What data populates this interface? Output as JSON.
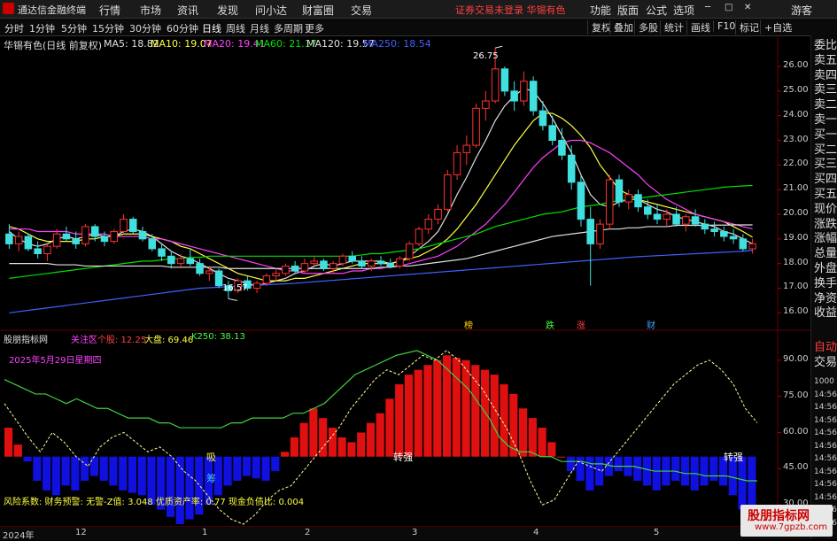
{
  "titlebar": {
    "app_name": "通达信金融终端",
    "menu": [
      "行情",
      "市场",
      "资讯",
      "发现",
      "问小达",
      "财富圈",
      "交易"
    ],
    "promo": "证券交易未登录  华锡有色",
    "right_buttons": [
      "功能",
      "版面",
      "公式",
      "选项"
    ],
    "guest": "游客"
  },
  "toolbar": {
    "timeframes": [
      "分时",
      "1分钟",
      "5分钟",
      "15分钟",
      "30分钟",
      "60分钟",
      "日线",
      "周线",
      "月线",
      "多周期",
      "更多"
    ],
    "active_timeframe": "日线",
    "buttons": [
      "复权",
      "叠加",
      "多股",
      "统计",
      "画线",
      "F10",
      "标记",
      "+自选"
    ]
  },
  "ma_legend": {
    "stock": "华锡有色(日线 前复权)",
    "items": [
      {
        "label": "MA5: 18.82",
        "color": "#e0e0e0"
      },
      {
        "label": "MA10: 19.07",
        "color": "#ffff40"
      },
      {
        "label": "MA20: 19.41",
        "color": "#ff40ff"
      },
      {
        "label": "MA60: 21.17",
        "color": "#00e000"
      },
      {
        "label": "MA120: 19.57",
        "color": "#e0e0e0"
      },
      {
        "label": "MA250: 18.54",
        "color": "#4060ff"
      }
    ]
  },
  "right_panel": [
    "委比",
    "卖五",
    "卖四",
    "卖三",
    "卖二",
    "卖一",
    "买一",
    "买二",
    "买三",
    "买四",
    "买五",
    "现价",
    "涨跌",
    "涨幅",
    "总量",
    "外盘",
    "换手",
    "净资",
    "收益"
  ],
  "right_panel_lower": [
    "自动",
    "交易"
  ],
  "right_small_ticks": [
    "1000",
    "14:56",
    "14:56",
    "14:56",
    "14:56",
    "14:56",
    "14:56",
    "14:56",
    "14:56",
    "14:56",
    "14:56",
    "14:56"
  ],
  "main_price_labels": [
    "26.00",
    "25.00",
    "24.00",
    "23.00",
    "22.00",
    "21.00",
    "20.00",
    "19.00",
    "18.00",
    "17.00",
    "16.00"
  ],
  "high_marker": "26.75",
  "low_marker": "16.57",
  "event_labels": [
    {
      "text": "榜",
      "color": "#ffd000"
    },
    {
      "text": "跌",
      "color": "#40ff40"
    },
    {
      "text": "涨",
      "color": "#ff4040"
    },
    {
      "text": "财",
      "color": "#40a0ff"
    }
  ],
  "indicator": {
    "name": "股朋指标网",
    "zone_label": "关注区",
    "dash": "-",
    "stock_label": "个股: 12.25",
    "market_label": "大盘: 69.46",
    "k250_label": "K250: 38.13",
    "date_text": "2025年5月29日星期四",
    "axis_labels": [
      "90.00",
      "75.00",
      "60.00",
      "45.00",
      "30.00"
    ],
    "text_absorb": "吸",
    "text_chip": "筹",
    "text_turn1": "转强",
    "text_turn2": "转强",
    "risk_text": "风险系数: 财务预警: 无警-Z值: 3.048 优质资产率: 0.77 现金负债比: 0.004"
  },
  "xaxis": [
    "2024年",
    "12",
    "1",
    "2",
    "3",
    "4",
    "5"
  ],
  "watermark": {
    "title": "股朋指标网",
    "url": "www.7gpzb.com"
  },
  "chart_data": {
    "type": "candlestick",
    "title": "华锡有色(日线 前复权)",
    "ylim": [
      15.4,
      26.9
    ],
    "high": 26.75,
    "low": 16.57,
    "candles": [
      [
        19.2,
        19.6,
        18.6,
        18.8
      ],
      [
        18.8,
        19.3,
        18.5,
        19.1
      ],
      [
        19.1,
        19.2,
        18.5,
        18.6
      ],
      [
        18.6,
        18.9,
        18.2,
        18.4
      ],
      [
        18.4,
        18.8,
        18.1,
        18.7
      ],
      [
        18.7,
        19.4,
        18.6,
        19.2
      ],
      [
        19.2,
        19.5,
        18.9,
        19.0
      ],
      [
        19.0,
        19.3,
        18.6,
        18.8
      ],
      [
        18.8,
        19.6,
        18.7,
        19.5
      ],
      [
        19.5,
        19.6,
        18.9,
        19.1
      ],
      [
        19.1,
        19.3,
        18.7,
        18.9
      ],
      [
        18.9,
        19.4,
        18.8,
        19.3
      ],
      [
        19.3,
        20.0,
        19.2,
        19.8
      ],
      [
        19.8,
        19.9,
        19.2,
        19.3
      ],
      [
        19.3,
        19.5,
        18.9,
        19.0
      ],
      [
        19.0,
        19.2,
        18.5,
        18.6
      ],
      [
        18.6,
        18.8,
        18.1,
        18.3
      ],
      [
        18.3,
        18.5,
        17.8,
        18.0
      ],
      [
        18.0,
        18.4,
        17.8,
        18.2
      ],
      [
        18.2,
        18.6,
        17.9,
        18.0
      ],
      [
        18.0,
        18.2,
        17.5,
        17.6
      ],
      [
        17.6,
        17.9,
        17.3,
        17.7
      ],
      [
        17.7,
        17.8,
        17.0,
        17.1
      ],
      [
        17.1,
        17.3,
        16.57,
        16.9
      ],
      [
        16.9,
        17.4,
        16.8,
        17.3
      ],
      [
        17.3,
        17.5,
        16.9,
        17.0
      ],
      [
        17.0,
        17.3,
        16.8,
        17.2
      ],
      [
        17.2,
        17.6,
        17.1,
        17.5
      ],
      [
        17.5,
        17.8,
        17.3,
        17.6
      ],
      [
        17.6,
        18.0,
        17.5,
        17.9
      ],
      [
        17.9,
        18.1,
        17.6,
        17.7
      ],
      [
        17.7,
        18.2,
        17.6,
        18.0
      ],
      [
        18.0,
        18.3,
        17.8,
        18.1
      ],
      [
        18.1,
        18.2,
        17.7,
        17.8
      ],
      [
        17.8,
        18.1,
        17.6,
        18.0
      ],
      [
        18.0,
        18.4,
        17.9,
        18.3
      ],
      [
        18.3,
        18.5,
        18.0,
        18.1
      ],
      [
        18.1,
        18.3,
        17.8,
        17.9
      ],
      [
        17.9,
        18.2,
        17.7,
        18.1
      ],
      [
        18.1,
        18.3,
        17.9,
        18.0
      ],
      [
        18.0,
        18.2,
        17.8,
        17.9
      ],
      [
        17.9,
        18.3,
        17.8,
        18.2
      ],
      [
        18.2,
        18.9,
        18.1,
        18.8
      ],
      [
        18.8,
        19.5,
        18.7,
        19.4
      ],
      [
        19.4,
        20.0,
        19.2,
        19.8
      ],
      [
        19.8,
        20.4,
        19.6,
        20.2
      ],
      [
        20.2,
        21.8,
        20.1,
        21.6
      ],
      [
        21.6,
        22.8,
        21.4,
        22.5
      ],
      [
        22.5,
        23.2,
        22.0,
        22.8
      ],
      [
        22.8,
        24.5,
        22.7,
        24.3
      ],
      [
        24.3,
        25.0,
        23.8,
        24.6
      ],
      [
        24.6,
        26.75,
        24.5,
        25.9
      ],
      [
        25.9,
        26.0,
        24.8,
        25.0
      ],
      [
        25.0,
        25.4,
        24.2,
        24.6
      ],
      [
        24.6,
        25.8,
        24.4,
        25.4
      ],
      [
        25.4,
        25.6,
        24.0,
        24.2
      ],
      [
        24.2,
        24.6,
        23.4,
        23.6
      ],
      [
        23.6,
        24.0,
        22.8,
        23.0
      ],
      [
        23.0,
        23.5,
        22.2,
        22.4
      ],
      [
        22.4,
        22.8,
        21.0,
        21.3
      ],
      [
        21.3,
        21.6,
        19.5,
        19.8
      ],
      [
        19.8,
        20.3,
        17.1,
        18.8
      ],
      [
        18.8,
        19.8,
        18.6,
        19.6
      ],
      [
        19.6,
        21.6,
        19.4,
        21.4
      ],
      [
        21.4,
        21.6,
        20.3,
        20.5
      ],
      [
        20.5,
        21.0,
        20.2,
        20.8
      ],
      [
        20.8,
        21.0,
        20.1,
        20.3
      ],
      [
        20.3,
        20.6,
        19.8,
        20.0
      ],
      [
        20.0,
        20.4,
        19.6,
        19.8
      ],
      [
        19.8,
        20.2,
        19.5,
        20.0
      ],
      [
        20.0,
        20.3,
        19.5,
        19.6
      ],
      [
        19.6,
        20.0,
        19.3,
        19.9
      ],
      [
        19.9,
        20.2,
        19.5,
        19.6
      ],
      [
        19.6,
        19.8,
        19.2,
        19.4
      ],
      [
        19.4,
        19.7,
        19.1,
        19.3
      ],
      [
        19.3,
        19.5,
        18.9,
        19.1
      ],
      [
        19.1,
        19.4,
        18.8,
        19.0
      ],
      [
        19.0,
        19.2,
        18.5,
        18.6
      ],
      [
        18.6,
        19.0,
        18.4,
        18.8
      ]
    ],
    "ma_series": [
      {
        "name": "MA5",
        "color": "#e0e0e0",
        "values": [
          19.3,
          19.0,
          18.8,
          18.7,
          18.8,
          19.0,
          19.1,
          19.0,
          19.1,
          19.2,
          19.1,
          19.1,
          19.3,
          19.4,
          19.3,
          19.1,
          18.8,
          18.5,
          18.3,
          18.2,
          18.0,
          17.8,
          17.6,
          17.4,
          17.3,
          17.2,
          17.1,
          17.2,
          17.3,
          17.4,
          17.6,
          17.7,
          17.9,
          18.0,
          17.9,
          18.0,
          18.1,
          18.1,
          18.1,
          18.1,
          18.0,
          18.1,
          18.3,
          18.6,
          18.9,
          19.3,
          20.0,
          20.8,
          21.5,
          22.3,
          23.0,
          23.8,
          24.4,
          24.8,
          25.1,
          25.0,
          24.5,
          23.9,
          23.2,
          22.5,
          21.6,
          20.8,
          20.4,
          20.3,
          20.5,
          20.6,
          20.6,
          20.4,
          20.2,
          20.1,
          19.9,
          19.8,
          19.7,
          19.6,
          19.5,
          19.3,
          19.2,
          19.0,
          18.8
        ]
      },
      {
        "name": "MA10",
        "color": "#ffff40",
        "values": [
          19.5,
          19.4,
          19.2,
          19.0,
          18.9,
          18.9,
          18.9,
          18.9,
          19.0,
          19.0,
          19.1,
          19.1,
          19.2,
          19.2,
          19.2,
          19.1,
          19.0,
          18.9,
          18.7,
          18.6,
          18.4,
          18.2,
          18.0,
          17.8,
          17.6,
          17.5,
          17.4,
          17.3,
          17.3,
          17.3,
          17.4,
          17.4,
          17.5,
          17.6,
          17.7,
          17.8,
          17.9,
          18.0,
          18.0,
          18.0,
          18.0,
          18.1,
          18.2,
          18.3,
          18.5,
          18.7,
          19.0,
          19.4,
          19.9,
          20.4,
          21.0,
          21.6,
          22.2,
          22.8,
          23.3,
          23.8,
          24.1,
          24.1,
          23.9,
          23.6,
          23.2,
          22.7,
          22.0,
          21.5,
          21.0,
          20.8,
          20.6,
          20.5,
          20.4,
          20.3,
          20.2,
          20.1,
          20.0,
          19.9,
          19.8,
          19.7,
          19.5,
          19.3,
          19.07
        ]
      },
      {
        "name": "MA20",
        "color": "#ff40ff",
        "values": [
          19.4,
          19.4,
          19.4,
          19.3,
          19.3,
          19.3,
          19.3,
          19.2,
          19.2,
          19.2,
          19.2,
          19.1,
          19.1,
          19.1,
          19.1,
          19.0,
          19.0,
          18.9,
          18.8,
          18.7,
          18.6,
          18.5,
          18.4,
          18.3,
          18.2,
          18.1,
          18.0,
          17.9,
          17.8,
          17.7,
          17.7,
          17.6,
          17.6,
          17.6,
          17.6,
          17.6,
          17.7,
          17.7,
          17.8,
          17.8,
          17.9,
          17.9,
          18.0,
          18.1,
          18.2,
          18.3,
          18.5,
          18.7,
          19.0,
          19.3,
          19.6,
          20.0,
          20.4,
          20.9,
          21.4,
          21.9,
          22.3,
          22.6,
          22.9,
          23.0,
          23.0,
          22.9,
          22.7,
          22.5,
          22.2,
          21.9,
          21.6,
          21.2,
          20.9,
          20.6,
          20.4,
          20.2,
          20.0,
          19.9,
          19.8,
          19.7,
          19.6,
          19.5,
          19.41
        ]
      },
      {
        "name": "MA60",
        "color": "#00e000",
        "values": [
          17.4,
          17.45,
          17.5,
          17.55,
          17.6,
          17.65,
          17.7,
          17.75,
          17.8,
          17.85,
          17.9,
          17.95,
          18.0,
          18.05,
          18.1,
          18.1,
          18.15,
          18.2,
          18.2,
          18.25,
          18.25,
          18.3,
          18.3,
          18.3,
          18.3,
          18.3,
          18.3,
          18.3,
          18.3,
          18.3,
          18.3,
          18.3,
          18.3,
          18.3,
          18.3,
          18.3,
          18.3,
          18.35,
          18.4,
          18.4,
          18.45,
          18.5,
          18.55,
          18.6,
          18.7,
          18.8,
          18.9,
          19.0,
          19.1,
          19.2,
          19.35,
          19.5,
          19.6,
          19.7,
          19.8,
          19.9,
          20.0,
          20.05,
          20.1,
          20.2,
          20.3,
          20.35,
          20.4,
          20.5,
          20.55,
          20.6,
          20.65,
          20.7,
          20.75,
          20.8,
          20.85,
          20.9,
          20.95,
          21.0,
          21.05,
          21.1,
          21.13,
          21.15,
          21.17
        ]
      },
      {
        "name": "MA120",
        "color": "#e0e0e0",
        "values": [
          18.0,
          18.0,
          18.0,
          18.0,
          18.0,
          17.95,
          17.95,
          17.95,
          17.9,
          17.9,
          17.9,
          17.9,
          17.9,
          17.9,
          17.9,
          17.9,
          17.9,
          17.85,
          17.85,
          17.85,
          17.85,
          17.85,
          17.85,
          17.8,
          17.8,
          17.8,
          17.8,
          17.8,
          17.8,
          17.8,
          17.8,
          17.8,
          17.8,
          17.8,
          17.8,
          17.8,
          17.8,
          17.8,
          17.8,
          17.85,
          17.85,
          17.9,
          17.9,
          17.95,
          18.0,
          18.05,
          18.1,
          18.15,
          18.2,
          18.3,
          18.4,
          18.5,
          18.6,
          18.7,
          18.8,
          18.9,
          19.0,
          19.1,
          19.15,
          19.2,
          19.25,
          19.3,
          19.35,
          19.4,
          19.4,
          19.45,
          19.45,
          19.5,
          19.5,
          19.5,
          19.55,
          19.55,
          19.55,
          19.55,
          19.56,
          19.56,
          19.57,
          19.57,
          19.57
        ]
      },
      {
        "name": "MA250",
        "color": "#4060ff",
        "values": [
          16.0,
          16.05,
          16.1,
          16.15,
          16.2,
          16.25,
          16.3,
          16.35,
          16.4,
          16.45,
          16.5,
          16.55,
          16.6,
          16.65,
          16.7,
          16.75,
          16.8,
          16.85,
          16.9,
          16.95,
          17.0,
          17.02,
          17.04,
          17.06,
          17.08,
          17.1,
          17.12,
          17.14,
          17.16,
          17.18,
          17.2,
          17.23,
          17.26,
          17.29,
          17.32,
          17.35,
          17.38,
          17.41,
          17.44,
          17.47,
          17.5,
          17.53,
          17.56,
          17.59,
          17.62,
          17.65,
          17.68,
          17.71,
          17.74,
          17.77,
          17.8,
          17.83,
          17.86,
          17.89,
          17.92,
          17.95,
          17.98,
          18.01,
          18.04,
          18.07,
          18.1,
          18.13,
          18.16,
          18.19,
          18.22,
          18.25,
          18.28,
          18.3,
          18.32,
          18.34,
          18.36,
          18.38,
          18.4,
          18.42,
          18.44,
          18.46,
          18.48,
          18.5,
          18.54
        ]
      }
    ],
    "indicator": {
      "ylim": [
        22,
        98
      ],
      "baseline": 50,
      "bars": [
        62,
        55,
        48,
        40,
        36,
        34,
        38,
        36,
        40,
        42,
        40,
        38,
        36,
        35,
        34,
        30,
        28,
        25,
        22,
        24,
        26,
        30,
        34,
        38,
        40,
        42,
        41,
        40,
        44,
        52,
        58,
        64,
        70,
        66,
        62,
        58,
        56,
        60,
        64,
        68,
        74,
        80,
        84,
        86,
        88,
        90,
        92,
        91,
        90,
        88,
        86,
        84,
        80,
        76,
        70,
        66,
        62,
        56,
        50,
        44,
        40,
        36,
        38,
        42,
        44,
        42,
        40,
        38,
        36,
        38,
        40,
        38,
        36,
        38,
        40,
        38,
        34,
        28,
        24
      ],
      "white_line": [
        72,
        65,
        58,
        52,
        60,
        56,
        50,
        46,
        54,
        58,
        60,
        56,
        52,
        54,
        50,
        44,
        40,
        34,
        28,
        24,
        22,
        26,
        32,
        36,
        38,
        44,
        50,
        56,
        62,
        70,
        76,
        82,
        86,
        84,
        88,
        92,
        90,
        94,
        90,
        84,
        78,
        70,
        62,
        52,
        40,
        30,
        32,
        40,
        48,
        46,
        44,
        50,
        56,
        62,
        68,
        74,
        80,
        84,
        88,
        90,
        86,
        80,
        70,
        64
      ],
      "green_line": [
        82,
        80,
        78,
        76,
        76,
        74,
        72,
        74,
        72,
        70,
        70,
        68,
        66,
        66,
        66,
        64,
        64,
        62,
        62,
        62,
        62,
        62,
        64,
        64,
        66,
        66,
        66,
        66,
        68,
        68,
        70,
        72,
        76,
        80,
        84,
        86,
        88,
        90,
        92,
        93,
        94,
        92,
        90,
        86,
        82,
        78,
        72,
        66,
        58,
        54,
        52,
        52,
        50,
        50,
        48,
        48,
        48,
        47,
        47,
        46,
        46,
        46,
        45,
        44,
        44,
        44,
        43,
        43,
        42,
        42,
        42,
        41,
        40,
        40
      ]
    }
  }
}
